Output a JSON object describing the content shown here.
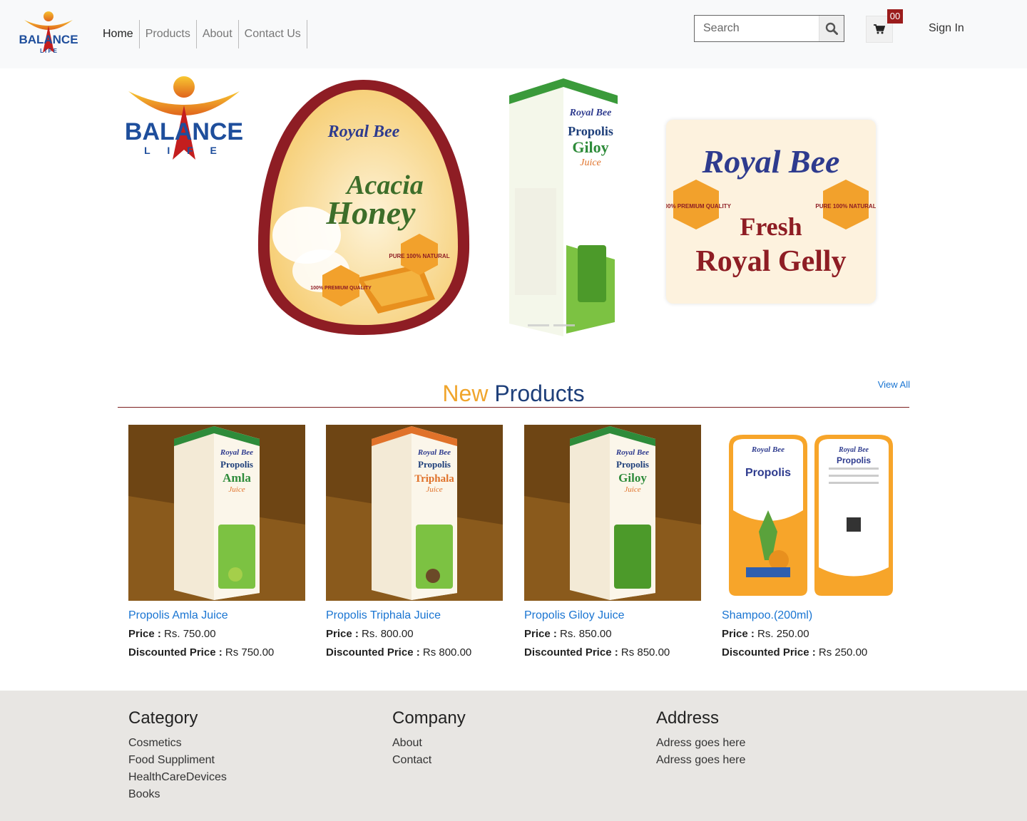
{
  "header": {
    "brand_top": "BALANCE",
    "brand_bottom": "L I F E",
    "nav": [
      "Home",
      "Products",
      "About",
      "Contact Us"
    ],
    "search_placeholder": "Search",
    "cart_count": "00",
    "signin_label": "Sign In"
  },
  "hero": {
    "logo_top": "BALANCE",
    "logo_bottom": "L I F E",
    "slides": [
      {
        "brand": "Royal Bee",
        "title_1": "Acacia",
        "title_2": "Honey",
        "badge_1": "PURE 100% NATURAL",
        "badge_2": "100% PREMIUM QUALITY"
      },
      {
        "brand": "Royal Bee",
        "title_1": "Propolis",
        "title_2": "Giloy",
        "title_3": "Juice"
      },
      {
        "brand": "Royal Bee",
        "title_1": "Fresh",
        "title_2": "Royal Gelly",
        "badge_1": "100% PREMIUM QUALITY",
        "badge_2": "PURE 100% NATURAL"
      }
    ]
  },
  "new_products": {
    "title_word_1": "New",
    "title_word_2": "Products",
    "view_all": "View All",
    "price_label": "Price :",
    "discount_label": "Discounted Price :",
    "items": [
      {
        "name": "Propolis Amla Juice",
        "price": "Rs. 750.00",
        "discounted": "Rs 750.00",
        "variant": "Amla",
        "accent": "#2e8b3a"
      },
      {
        "name": "Propolis Triphala Juice",
        "price": "Rs. 800.00",
        "discounted": "Rs 800.00",
        "variant": "Triphala",
        "accent": "#e0722a"
      },
      {
        "name": "Propolis Giloy Juice",
        "price": "Rs. 850.00",
        "discounted": "Rs 850.00",
        "variant": "Giloy",
        "accent": "#2e8b3a"
      },
      {
        "name": "Shampoo.(200ml)",
        "price": "Rs. 250.00",
        "discounted": "Rs 250.00",
        "variant": "Propolis",
        "accent": "#f2a02c"
      }
    ]
  },
  "footer": {
    "category": {
      "title": "Category",
      "links": [
        "Cosmetics",
        "Food Suppliment",
        "HealthCareDevices",
        "Books"
      ]
    },
    "company": {
      "title": "Company",
      "links": [
        "About",
        "Contact"
      ]
    },
    "address": {
      "title": "Address",
      "lines": [
        "Adress goes here",
        "Adress goes here"
      ]
    }
  },
  "colors": {
    "header_bg": "#f8f9fa",
    "footer_bg": "#e8e6e3",
    "link": "#1a75d2",
    "accent_orange": "#f0a52c",
    "accent_navy": "#1e3f7a",
    "badge_red": "#9b1c1c"
  }
}
